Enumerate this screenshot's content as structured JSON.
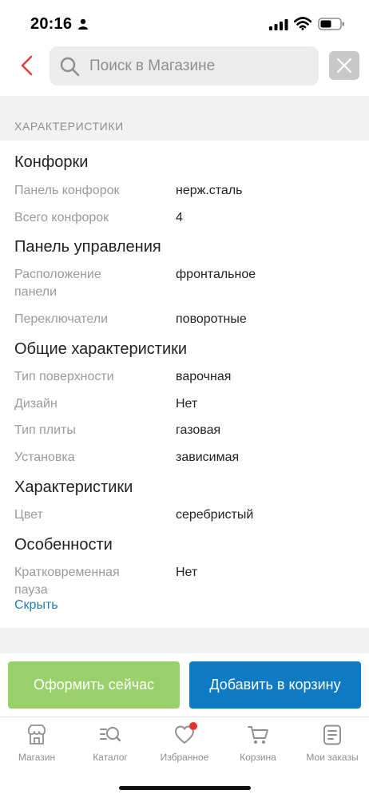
{
  "status_bar": {
    "time": "20:16"
  },
  "search": {
    "placeholder": "Поиск в Магазине",
    "value": ""
  },
  "section": {
    "title": "ХАРАКТЕРИСТИКИ"
  },
  "groups": [
    {
      "title": "Конфорки",
      "rows": [
        {
          "label": "Панель конфорок",
          "value": "нерж.сталь"
        },
        {
          "label": "Всего конфорок",
          "value": "4"
        }
      ]
    },
    {
      "title": "Панель управления",
      "rows": [
        {
          "label": "Расположение панели",
          "value": "фронтальное"
        },
        {
          "label": "Переключатели",
          "value": "поворотные"
        }
      ]
    },
    {
      "title": "Общие характеристики",
      "rows": [
        {
          "label": "Тип поверхности",
          "value": "варочная"
        },
        {
          "label": "Дизайн",
          "value": "Нет"
        },
        {
          "label": "Тип плиты",
          "value": "газовая"
        },
        {
          "label": "Установка",
          "value": "зависимая"
        }
      ]
    },
    {
      "title": "Характеристики",
      "rows": [
        {
          "label": "Цвет",
          "value": "серебристый"
        }
      ]
    },
    {
      "title": "Особенности",
      "rows": [
        {
          "label": "Кратковременная пауза",
          "value": "Нет"
        }
      ]
    }
  ],
  "collapse_label": "Скрыть",
  "actions": {
    "checkout_label": "Оформить сейчас",
    "add_to_cart_label": "Добавить в корзину"
  },
  "tabs": [
    {
      "label": "Магазин",
      "icon": "store-icon"
    },
    {
      "label": "Каталог",
      "icon": "catalog-search-icon"
    },
    {
      "label": "Избранное",
      "icon": "heart-icon",
      "badge": true
    },
    {
      "label": "Корзина",
      "icon": "cart-icon"
    },
    {
      "label": "Мои заказы",
      "icon": "orders-icon"
    }
  ],
  "colors": {
    "accent_red": "#e0433a",
    "checkout_green": "#9ad06a",
    "primary_blue": "#0e7ac4",
    "link_blue": "#1a7fc4",
    "badge_red": "#e8322b"
  }
}
